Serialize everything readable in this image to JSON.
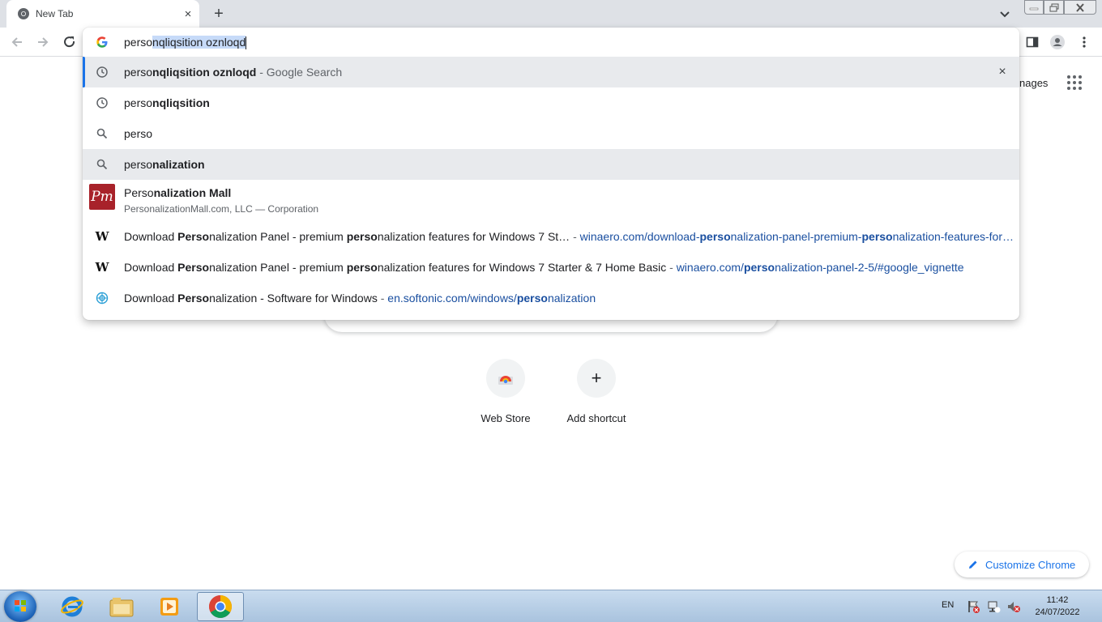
{
  "browser": {
    "tab": {
      "title": "New Tab",
      "close": "×"
    },
    "new_tab": "+"
  },
  "omnibox": {
    "typed": "perso",
    "completion": "nqliqsition oznloqd",
    "suggestions": [
      {
        "type": "history",
        "prefix": "perso",
        "bold": "nqliqsition oznloqd",
        "suffix": " - Google Search",
        "remove": "×"
      },
      {
        "type": "history",
        "prefix": "perso",
        "bold": "nqliqsition"
      },
      {
        "type": "search",
        "prefix": "perso",
        "bold": ""
      },
      {
        "type": "search",
        "prefix": "perso",
        "bold": "nalization"
      }
    ],
    "entity": {
      "logo_text": "Pm",
      "name_prefix": "Perso",
      "name_bold": "nalization Mall",
      "description": "PersonalizationMall.com, LLC — Corporation"
    },
    "results": [
      {
        "icon": "W",
        "t1": "Download ",
        "t2": "Perso",
        "t3": "nalization Panel - premium ",
        "t4": "perso",
        "t5": "nalization features for Windows 7 St…",
        "sep": " - ",
        "u1": "winaero.com/download-",
        "u2": "perso",
        "u3": "nalization-panel-premium-",
        "u4": "perso",
        "u5": "nalization-features-for…"
      },
      {
        "icon": "W",
        "t1": "Download ",
        "t2": "Perso",
        "t3": "nalization Panel - premium ",
        "t4": "perso",
        "t5": "nalization features for Windows 7 Starter & 7 Home Basic",
        "sep": " - ",
        "u1": "winaero.com/",
        "u2": "perso",
        "u3": "nalization-panel-2-5/#google_vignette"
      },
      {
        "t1": "Download ",
        "t2": "Perso",
        "t3": "nalization - Software for Windows",
        "sep": " - ",
        "u1": "en.softonic.com/windows/",
        "u2": "perso",
        "u3": "nalization"
      }
    ]
  },
  "page": {
    "images_link": "nages",
    "shortcuts": [
      {
        "label": "Web Store"
      },
      {
        "label": "Add shortcut",
        "symbol": "+"
      }
    ],
    "customize": "Customize Chrome"
  },
  "taskbar": {
    "language": "EN",
    "time": "11:42",
    "date": "24/07/2022"
  }
}
